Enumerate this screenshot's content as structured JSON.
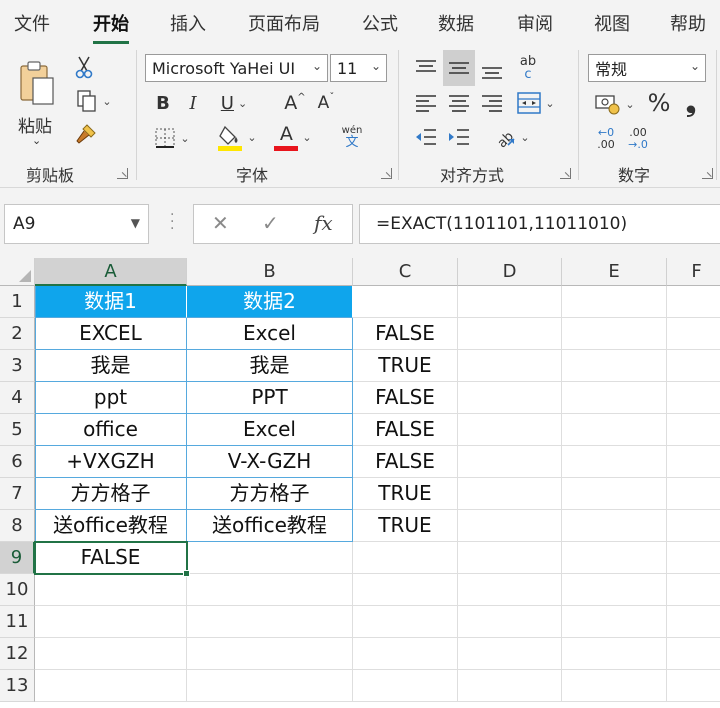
{
  "ribbon_tabs": [
    "文件",
    "开始",
    "插入",
    "页面布局",
    "公式",
    "数据",
    "审阅",
    "视图",
    "帮助"
  ],
  "active_tab": "开始",
  "clipboard": {
    "paste_label": "粘贴",
    "group_label": "剪贴板"
  },
  "font": {
    "family": "Microsoft YaHei UI",
    "size": "11",
    "bold": "B",
    "italic": "I",
    "underline": "U",
    "grow": "A",
    "shrink": "A",
    "color": "A",
    "phonetic_top": "wén",
    "phonetic_bottom": "文",
    "group_label": "字体",
    "highlight_color": "#ffe600",
    "font_color": "#e8141c"
  },
  "alignment": {
    "group_label": "对齐方式",
    "wrap_top": "ab",
    "wrap_bottom": "c"
  },
  "number": {
    "format": "常规",
    "percent": "%",
    "comma": "❟",
    "group_label": "数字",
    "inc_top": "←0",
    "inc_bottom": ".00",
    "dec_top": ".00",
    "dec_bottom": "→.0"
  },
  "formula_bar": {
    "name_box": "A9",
    "cancel": "✕",
    "enter": "✓",
    "fx": "fx",
    "formula": "=EXACT(1101101,11011010)"
  },
  "columns": [
    "A",
    "B",
    "C",
    "D",
    "E",
    "F"
  ],
  "selected_column": "A",
  "rows": [
    "1",
    "2",
    "3",
    "4",
    "5",
    "6",
    "7",
    "8",
    "9",
    "10",
    "11",
    "12",
    "13"
  ],
  "selected_row": "9",
  "cells": [
    [
      "数据1",
      "数据2",
      ""
    ],
    [
      "EXCEL",
      "Excel",
      "FALSE"
    ],
    [
      "我是",
      "我是",
      "TRUE"
    ],
    [
      "ppt",
      "PPT",
      "FALSE"
    ],
    [
      "office",
      "Excel",
      "FALSE"
    ],
    [
      "+VXGZH",
      "V-X-GZH",
      "FALSE"
    ],
    [
      "方方格子",
      "方方格子",
      "TRUE"
    ],
    [
      "送office教程",
      "送office教程",
      "TRUE"
    ],
    [
      "FALSE",
      "",
      ""
    ]
  ],
  "colors": {
    "table_header": "#0fa5ec",
    "table_border": "#56a9de",
    "selection": "#217346"
  }
}
